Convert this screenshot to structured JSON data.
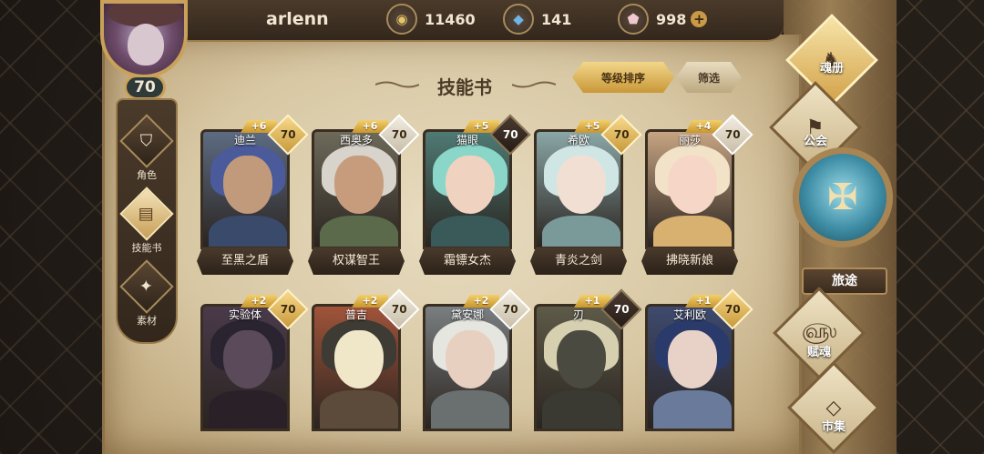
{
  "player": {
    "username": "arlenn",
    "level": "70"
  },
  "resources": {
    "gold": "11460",
    "crystal": "141",
    "gem": "998",
    "gem_plus": "+"
  },
  "left_nav": [
    {
      "label": "角色",
      "icon": "helmet-icon"
    },
    {
      "label": "技能书",
      "icon": "book-icon"
    },
    {
      "label": "素材",
      "icon": "material-icon"
    }
  ],
  "header": {
    "title": "技能书",
    "sort_label": "等级排序",
    "filter_label": "筛选"
  },
  "cards": [
    {
      "hero": "迪兰",
      "bonus": "+6",
      "level": "70",
      "book": "至黑之盾",
      "colors": {
        "bg": "#5d6b82",
        "hair": "#4a5a9a",
        "skin": "#c09a7a",
        "body": "#3a4a6a"
      },
      "badge": "gold"
    },
    {
      "hero": "西奥多",
      "bonus": "+6",
      "level": "70",
      "book": "权谋智王",
      "colors": {
        "bg": "#6e6a5a",
        "hair": "#d8d4cc",
        "skin": "#c79c7c",
        "body": "#5a6a4a"
      },
      "badge": "gray"
    },
    {
      "hero": "猫眼",
      "bonus": "+5",
      "level": "70",
      "book": "霜镖女杰",
      "colors": {
        "bg": "#4f7a74",
        "hair": "#8ad6c8",
        "skin": "#f0d2c0",
        "body": "#3a5a5a"
      },
      "badge": "dark"
    },
    {
      "hero": "希欧",
      "bonus": "+5",
      "level": "70",
      "book": "青炎之剑",
      "colors": {
        "bg": "#8aa6a6",
        "hair": "#cfe6e4",
        "skin": "#f2dfd4",
        "body": "#7a9a9a"
      },
      "badge": "gold"
    },
    {
      "hero": "丽莎",
      "bonus": "+4",
      "level": "70",
      "book": "拂晓新娘",
      "colors": {
        "bg": "#c6a482",
        "hair": "#f1e2c8",
        "skin": "#f6d6c6",
        "body": "#d8b070"
      },
      "badge": "gray"
    },
    {
      "hero": "实验体",
      "bonus": "+2",
      "level": "70",
      "book": "",
      "colors": {
        "bg": "#4a3a4a",
        "hair": "#2a2430",
        "skin": "#5a4a5a",
        "body": "#2a2028"
      },
      "badge": "gold"
    },
    {
      "hero": "普吉",
      "bonus": "+2",
      "level": "70",
      "book": "",
      "colors": {
        "bg": "#a0543a",
        "hair": "#3e3a34",
        "skin": "#f0e6c8",
        "body": "#5c4a3a"
      },
      "badge": "gray"
    },
    {
      "hero": "黛安娜",
      "bonus": "+2",
      "level": "70",
      "book": "",
      "colors": {
        "bg": "#7a7e80",
        "hair": "#e6e6e0",
        "skin": "#e8d0c0",
        "body": "#6a7070"
      },
      "badge": "gray"
    },
    {
      "hero": "刃",
      "bonus": "+1",
      "level": "70",
      "book": "",
      "colors": {
        "bg": "#5e5a48",
        "hair": "#d6d0b0",
        "skin": "#4a4a40",
        "body": "#3a3a32"
      },
      "badge": "dark"
    },
    {
      "hero": "艾利欧",
      "bonus": "+1",
      "level": "70",
      "book": "",
      "colors": {
        "bg": "#3e4a6e",
        "hair": "#2a3a6a",
        "skin": "#e8d2c8",
        "body": "#6a7a9a"
      },
      "badge": "gold"
    }
  ],
  "right_nav": {
    "soul_book": "魂册",
    "guild": "公会",
    "journey": "旅途",
    "talent": "赋魂",
    "market": "市集"
  }
}
